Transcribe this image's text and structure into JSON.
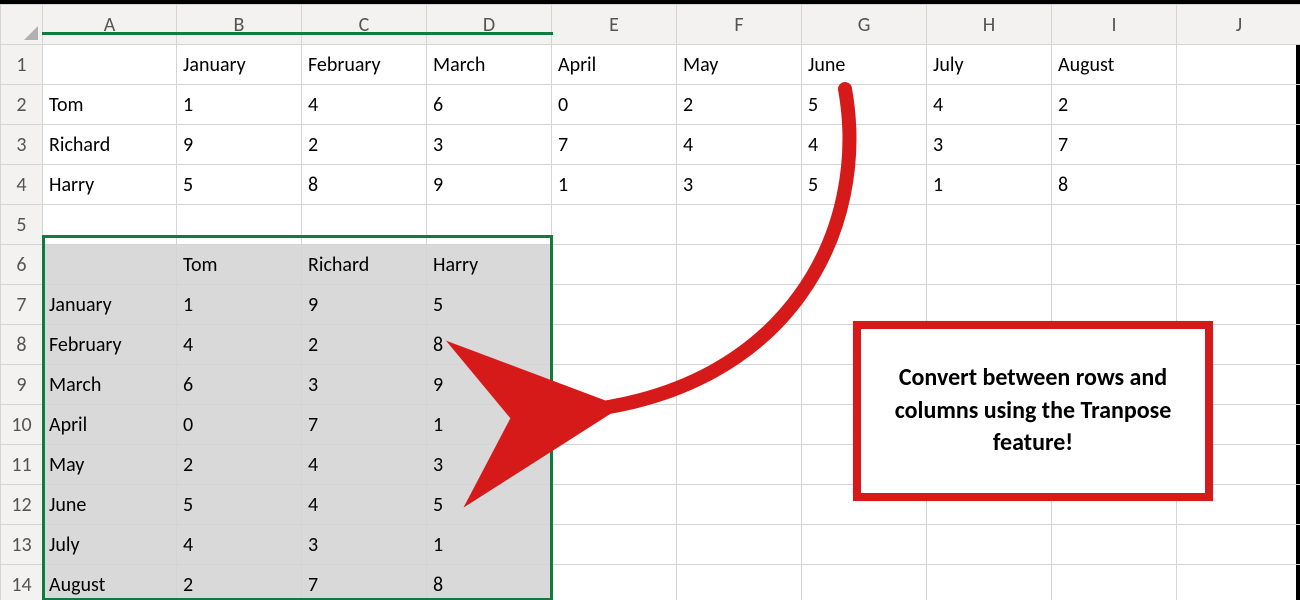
{
  "columns": [
    "A",
    "B",
    "C",
    "D",
    "E",
    "F",
    "G",
    "H",
    "I",
    "J"
  ],
  "rows": [
    "1",
    "2",
    "3",
    "4",
    "5",
    "6",
    "7",
    "8",
    "9",
    "10",
    "11",
    "12",
    "13",
    "14"
  ],
  "table1": {
    "headers": [
      "January",
      "February",
      "March",
      "April",
      "May",
      "June",
      "July",
      "August"
    ],
    "names": [
      "Tom",
      "Richard",
      "Harry"
    ],
    "data": {
      "Tom": [
        1,
        4,
        6,
        0,
        2,
        5,
        4,
        2
      ],
      "Richard": [
        9,
        2,
        3,
        7,
        4,
        4,
        3,
        7
      ],
      "Harry": [
        5,
        8,
        9,
        1,
        3,
        5,
        1,
        8
      ]
    }
  },
  "table2": {
    "headers": [
      "Tom",
      "Richard",
      "Harry"
    ],
    "rows": [
      "January",
      "February",
      "March",
      "April",
      "May",
      "June",
      "July",
      "August"
    ],
    "data": {
      "January": [
        1,
        9,
        5
      ],
      "February": [
        4,
        2,
        8
      ],
      "March": [
        6,
        3,
        9
      ],
      "April": [
        0,
        7,
        1
      ],
      "May": [
        2,
        4,
        3
      ],
      "June": [
        5,
        4,
        5
      ],
      "July": [
        4,
        3,
        1
      ],
      "August": [
        2,
        7,
        8
      ]
    }
  },
  "callout": {
    "text": "Convert between rows and columns using the Tranpose feature!"
  },
  "colors": {
    "selection": "#0f7b3e",
    "accent_red": "#d61a1a"
  }
}
